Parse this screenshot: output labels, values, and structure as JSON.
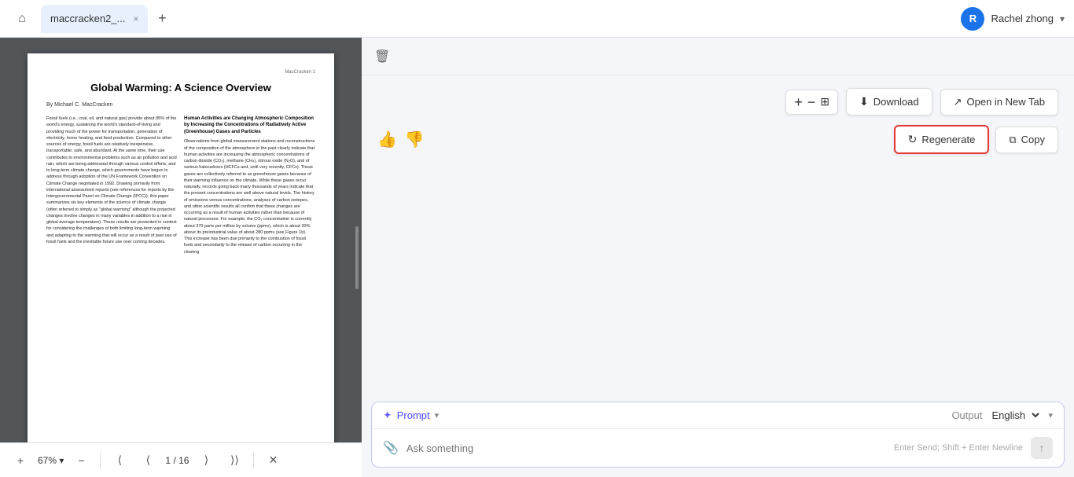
{
  "tab": {
    "label": "maccracken2_...",
    "close_label": "×"
  },
  "tab_add": "+",
  "user": {
    "initial": "R",
    "name": "Rachel zhong",
    "chevron": "▾"
  },
  "home_icon": "⌂",
  "pdf": {
    "header_text": "MacCracken     1",
    "title": "Global Warming: A Science Overview",
    "author": "By Michael C. MacCracken",
    "body_left": "Fossil fuels (i.e., coal, oil, and natural gas) provide about 85% of the world's energy, sustaining the world's standard-of-living and providing much of the power for transportation, generation of electricity, home heating, and food production. Compared to other sources of energy, fossil fuels are relatively inexpensive, transportable, safe, and abundant. At the same time, their use contributes to environmental problems such as air pollution and acid rain, which are being addressed through various control efforts, and to long-term climate change, which governments have begun to address through adoption of the UN Framework Convention on Climate Change negotiated in 1992.\n\nDrawing primarily from international assessment reports (see references for reports by the Intergovernmental Panel on Climate Change (IPCC)), this paper summarizes six key elements of the science of climate change (often referred to simply as \"global warming\" although the projected changes involve changes in many variables in addition to a rise in global average temperature). These results are presented in context for considering the challenges of both limiting long-term warming and adapting to the warming that will occur as a result of past use of fossil fuels and the inevitable future use over coming decades.",
    "subheading": "Human Activities are Changing Atmospheric Composition by Increasing the Concentrations of Radiatively Active (Greenhouse) Gases and Particles",
    "body_right": "Observations from global measurement stations and reconstructions of the composition of the atmosphere in the past clearly indicate that human activities are increasing the atmospheric concentrations of carbon dioxide (CO₂), methane (CH₄), nitrous oxide (N₂O), and of various halocarbons (HCFCs and, until very recently, CFCs). These gases are collectively referred to as greenhouse gases because of their warming influence on the climate.\n\nWhile these gases occur naturally, records going back many thousands of years indicate that the present concentrations are well above natural levels. The history of emissions versus concentrations, analyses of carbon isotopes, and other scientific results all confirm that these changes are occurring as a result of human activities rather than because of natural processes. For example, the CO₂ concentration is currently about 370 parts per million by volume (ppmv), which is about 30% above its preindustrial value of about 280 ppmv (see Figure 1b). This increase has been due primarily to the combustion of fossil fuels and secondarily to the release of carbon occurring in the clearing"
  },
  "pdf_toolbar": {
    "zoom_plus": "+",
    "zoom_minus": "−",
    "zoom_level": "67%",
    "separator": "-",
    "page_current": "1",
    "page_separator": "/",
    "page_total": "16",
    "nav_first": "⟨⟨",
    "nav_prev": "⟨",
    "nav_next": "⟩",
    "nav_last": "⟩⟩",
    "close": "✕"
  },
  "toolbar": {
    "zoom_plus": "+",
    "zoom_minus": "−",
    "fullscreen": "⊞",
    "download_label": "Download",
    "open_new_tab_label": "Open in New Tab",
    "thumbs_up": "👍",
    "thumbs_down": "👎",
    "regenerate_label": "Regenerate",
    "copy_label": "Copy"
  },
  "input": {
    "prompt_label": "Prompt",
    "prompt_icon": "✦",
    "prompt_arrow": "▾",
    "output_label": "Output",
    "lang_label": "English",
    "lang_arrow": "▾",
    "placeholder": "Ask something",
    "hint": "Enter Send; Shift + Enter Newline",
    "attach_icon": "📎",
    "send_icon": "↑"
  },
  "delete_icon": "🗑"
}
